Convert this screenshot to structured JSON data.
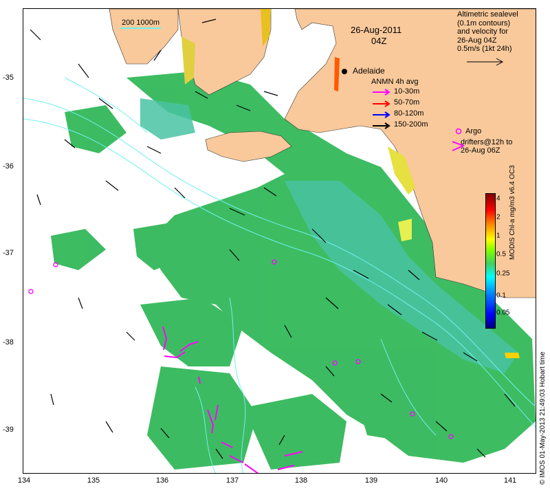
{
  "date_title": "26-Aug-2011",
  "time_title": "04Z",
  "scale_bar_label": "200  1000m",
  "city": "Adelaide",
  "altimetry_note": [
    "Altimetric sealevel",
    "(0.1m contours)",
    "and velocity for",
    "26-Aug 04Z",
    "0.5m/s (1kt 24h)"
  ],
  "anmn_title": "ANMN 4h avg",
  "anmn_legend": [
    {
      "label": "10-30m",
      "color": "#ff00ff"
    },
    {
      "label": "50-70m",
      "color": "#ff0000"
    },
    {
      "label": "80-120m",
      "color": "#0000ff"
    },
    {
      "label": "150-200m",
      "color": "#000000"
    }
  ],
  "argo_label": "Argo",
  "drifter_label": [
    "drifters@12h to",
    "26-Aug 06Z"
  ],
  "colorbar_ticks": [
    "4",
    "2",
    "1",
    "0.5",
    "0.25",
    "0.1",
    "0.05"
  ],
  "colorbar_label": "MODIS Chl-a mg/m3 v6.4 OC3",
  "credit": "© IMOS 01-May-2013 21:49:03 Hobart time",
  "lat_labels": [
    "-35",
    "-36",
    "-37",
    "-38",
    "-39"
  ],
  "lon_labels": [
    "134",
    "135",
    "136",
    "137",
    "138",
    "139",
    "140",
    "141"
  ],
  "colors": {
    "land": "#f9c99b",
    "ocean_chl": "#33b85a",
    "cyan_contour": "#6ff0f0",
    "magenta": "#ff00ff"
  }
}
